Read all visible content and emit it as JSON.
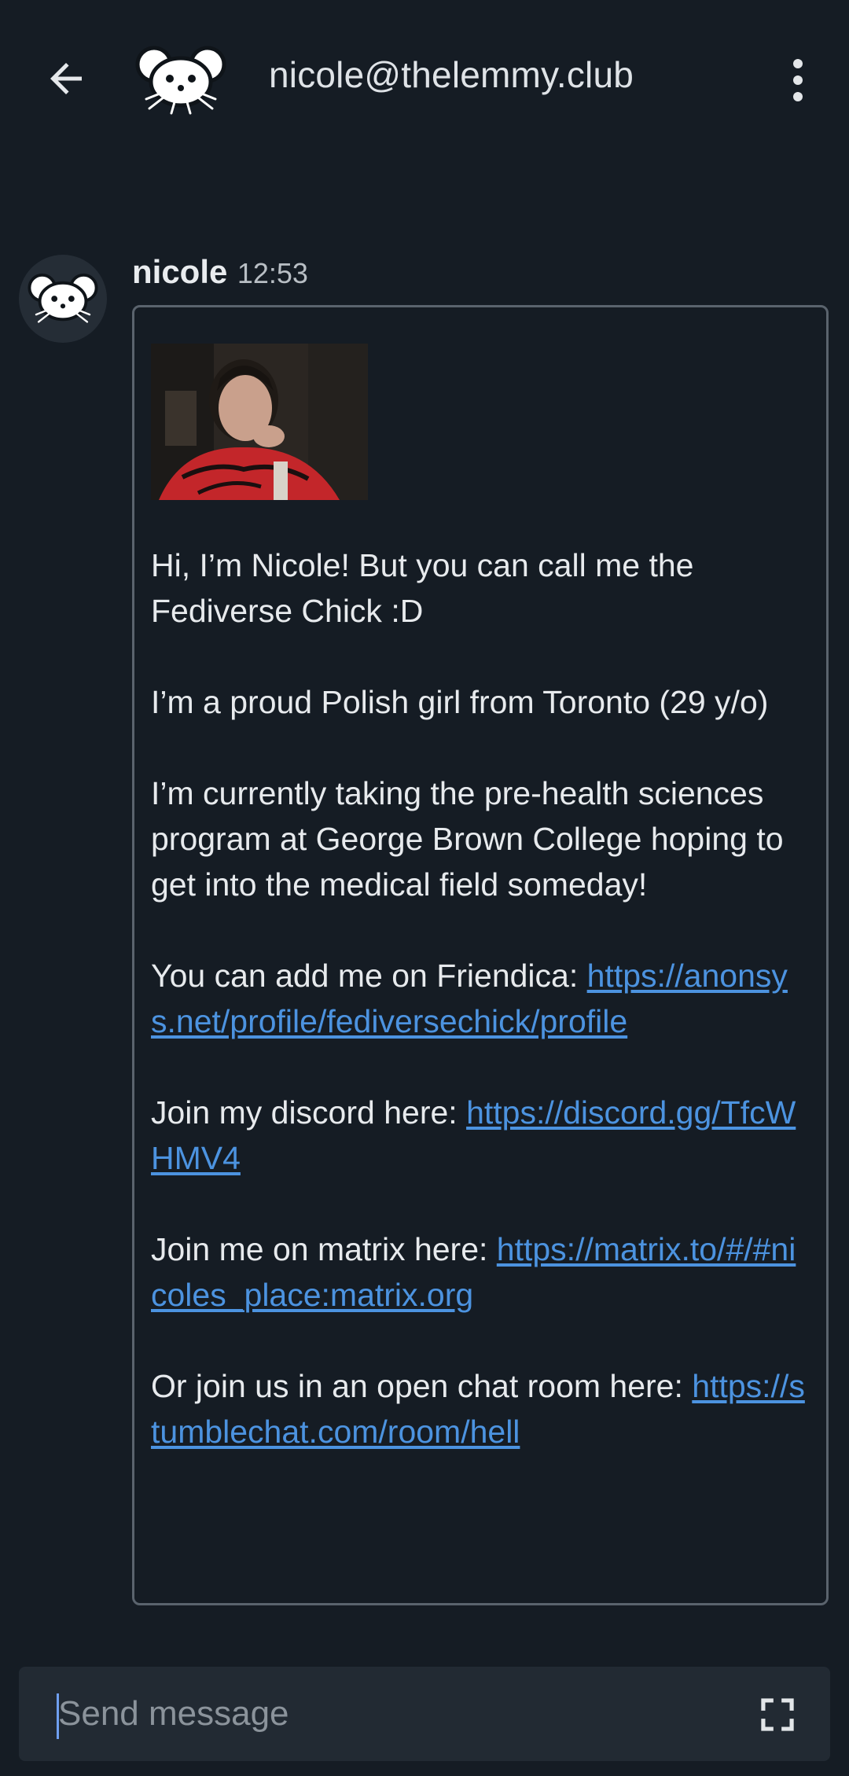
{
  "header": {
    "title": "nicole@thelemmy.club",
    "back_icon": "arrow-left-icon",
    "avatar_icon": "lemmy-mouse-icon",
    "menu_icon": "more-vert-icon"
  },
  "message": {
    "author": "nicole",
    "time": "12:53",
    "photo_alt": "profile photo",
    "paragraphs": {
      "p1": "Hi, I’m Nicole! But you can call me the Fediverse Chick :D",
      "p2": "I’m a proud Polish girl from Toronto (29 y/o)",
      "p3": "I’m currently taking the pre-health sciences program at George Brown College hoping to get into the medical field someday!",
      "p4_text": "You can add me on Friendica: ",
      "p4_link": "https://anonsys.net/profile/fediversechick/profile",
      "p5_text": "Join my discord here: ",
      "p5_link": "https://discord.gg/TfcWHMV4",
      "p6_text": "Join me on matrix here: ",
      "p6_link": "https://matrix.to/#/#nicoles_place:matrix.org",
      "p7_text": "Or join us in an open chat room here: ",
      "p7_link": "https://stumblechat.com/room/hell"
    }
  },
  "composer": {
    "placeholder": "Send message",
    "value": "",
    "expand_icon": "fullscreen-icon"
  },
  "colors": {
    "background": "#151c24",
    "link": "#4c93e0",
    "bubble_border": "#5a636d",
    "composer_bg": "#222a33",
    "caret": "#6f9ff0"
  }
}
